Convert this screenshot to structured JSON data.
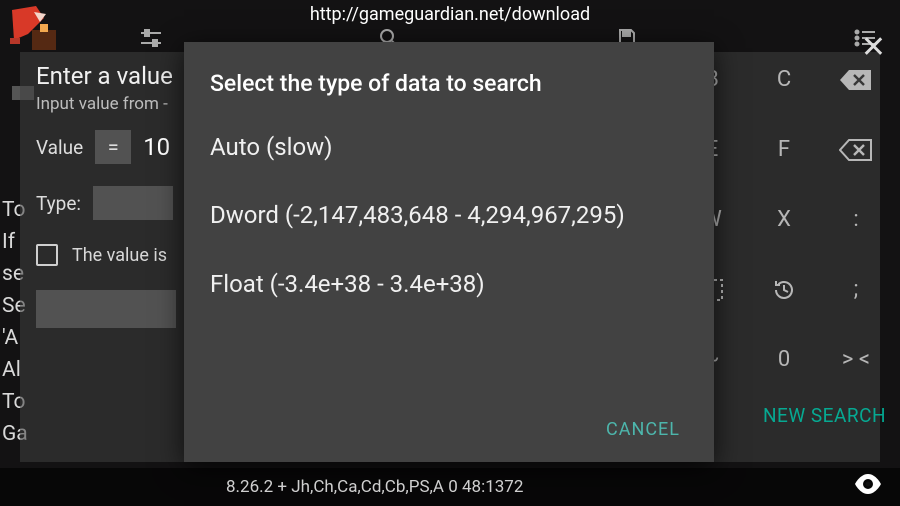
{
  "url": "http://gameguardian.net/download",
  "back_dialog": {
    "title": "Enter a value",
    "subtitle": "Input value from -",
    "value_label": "Value",
    "eq": "=",
    "value_text": "10",
    "type_label": "Type:",
    "checkbox_label": "The value is"
  },
  "left_lines": "To\nIf\nse\nSe\n'A\nAl\nTo\nGa",
  "right_keys": {
    "r1": [
      "B",
      "C",
      "bksp"
    ],
    "r2": [
      "E",
      "F",
      "bksp2"
    ],
    "r3": [
      "W",
      "X",
      ":"
    ],
    "r4": [
      "select",
      "history",
      ";"
    ],
    "r5": [
      "~",
      "0",
      "><"
    ]
  },
  "new_search_label": "NEW SEARCH",
  "front_modal": {
    "title": "Select the type of data to search",
    "options": [
      "Auto (slow)",
      "Dword (-2,147,483,648 - 4,294,967,295)",
      "Float (-3.4e+38 - 3.4e+38)"
    ],
    "cancel": "CANCEL"
  },
  "bottom_status": "8.26.2  +  Jh,Ch,Ca,Cd,Cb,PS,A  0  48:1372"
}
